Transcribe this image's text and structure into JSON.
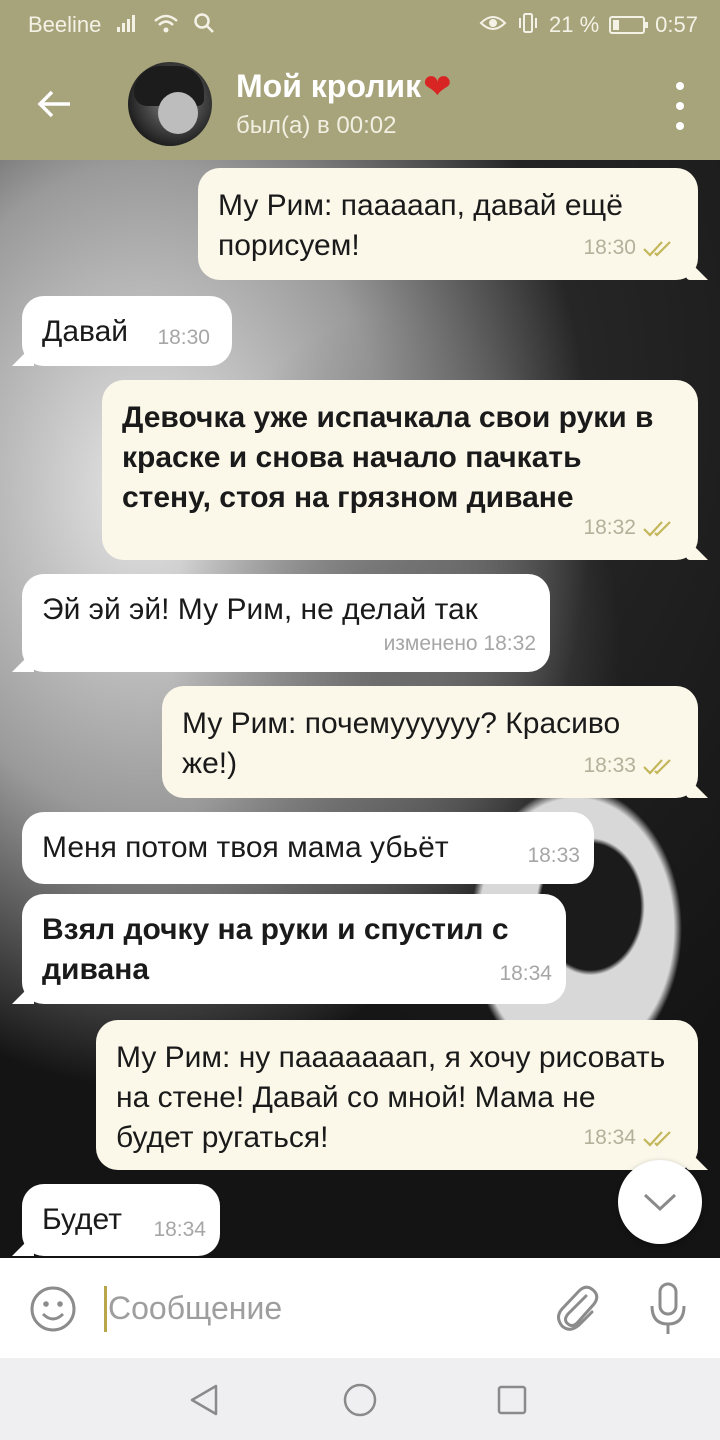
{
  "status_bar": {
    "carrier": "Beeline",
    "battery_percent": "21 %",
    "battery_level": 0.21,
    "time": "0:57"
  },
  "header": {
    "title": "Мой кролик",
    "title_emoji": "❤",
    "status": "был(а) в 00:02",
    "back_icon": "arrow-left-icon",
    "menu_icon": "more-vertical-icon"
  },
  "messages": [
    {
      "dir": "out",
      "text": "Му Рим: пааааап, давай ещё порисуем!",
      "time": "18:30",
      "read": true
    },
    {
      "dir": "in",
      "text": "Давай",
      "time": "18:30"
    },
    {
      "dir": "out",
      "text": "Девочка уже испачкала свои руки в краске и снова начало пачкать стену, стоя на грязном диване",
      "time": "18:32",
      "read": true,
      "bold": true
    },
    {
      "dir": "in",
      "text": "Эй эй эй! Му Рим, не делай так",
      "time": "изменено 18:32"
    },
    {
      "dir": "out",
      "text": "Му Рим: почемуууууу? Красиво же!)",
      "time": "18:33",
      "read": true
    },
    {
      "dir": "in",
      "text": "Меня потом твоя мама убьёт",
      "time": "18:33"
    },
    {
      "dir": "in",
      "text": "Взял дочку на руки и спустил с дивана",
      "time": "18:34",
      "bold": true
    },
    {
      "dir": "out",
      "text": "Му Рим: ну пааааааап, я хочу рисовать на стене! Давай со мной! Мама не будет ругаться!",
      "time": "18:34",
      "read": true
    },
    {
      "dir": "in",
      "text": "Будет",
      "time": "18:34"
    }
  ],
  "composer": {
    "placeholder": "Сообщение",
    "emoji_icon": "smiley-icon",
    "attach_icon": "paperclip-icon",
    "mic_icon": "microphone-icon"
  },
  "colors": {
    "header_bg": "#a7a37a",
    "outgoing_bubble": "#fbf8ea",
    "incoming_bubble": "#ffffff",
    "read_check": "#c4b65a",
    "heart": "#d92424"
  }
}
